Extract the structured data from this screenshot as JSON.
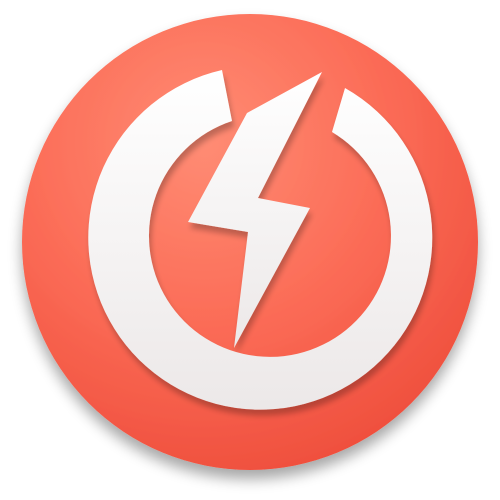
{
  "icon": {
    "name": "power-bolt-icon",
    "colors": {
      "badge_light": "#ff8a72",
      "badge_mid": "#fb6a55",
      "badge_dark": "#f2513f",
      "glyph": "#f4f1f1",
      "glyph_shade": "#d9d4d4",
      "shadow": "#c8402f"
    }
  }
}
